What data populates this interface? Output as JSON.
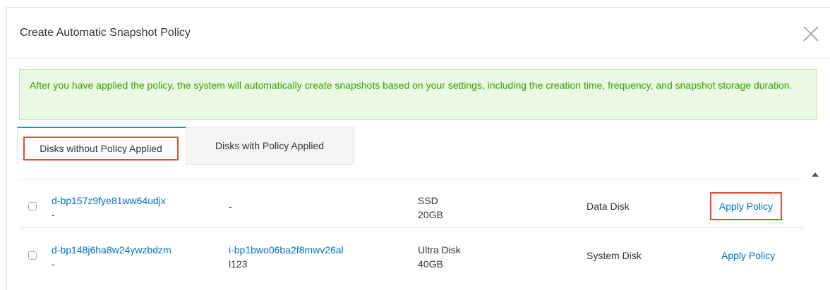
{
  "dialog": {
    "title": "Create Automatic Snapshot Policy",
    "notice": "After you have applied the policy, the system will automatically create snapshots based on your settings, including the creation time, frequency, and snapshot storage duration."
  },
  "tabs": [
    {
      "label": "Disks without Policy Applied",
      "active": true
    },
    {
      "label": "Disks with Policy Applied",
      "active": false
    }
  ],
  "rows": [
    {
      "disk_id": "d-bp157z9fye81ww64udjx",
      "disk_sub": "-",
      "instance_id": "-",
      "instance_sub": "",
      "type": "SSD",
      "size": "20GB",
      "role": "Data Disk",
      "action": "Apply Policy"
    },
    {
      "disk_id": "d-bp148j6ha8w24ywzbdzm",
      "disk_sub": "-",
      "instance_id": "i-bp1bwo06ba2f8mwv26al",
      "instance_sub": "l123",
      "type": "Ultra Disk",
      "size": "40GB",
      "role": "System Disk",
      "action": "Apply Policy"
    }
  ],
  "colors": {
    "accent": "#00a2ca",
    "link": "#0070cc",
    "highlight": "#e64c2e",
    "notice_text": "#3a9c00"
  }
}
